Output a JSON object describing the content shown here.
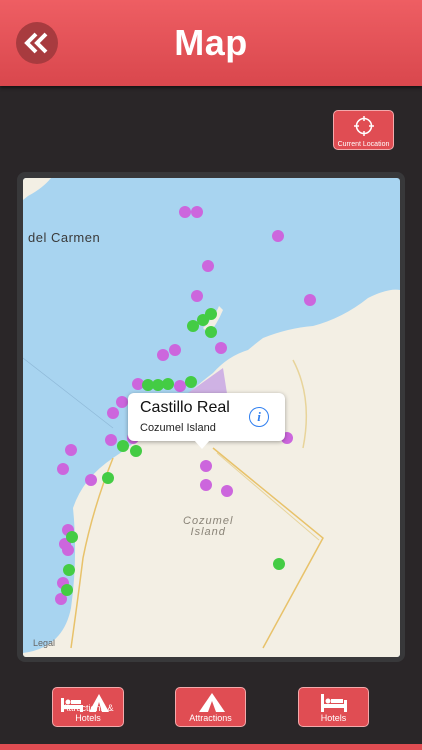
{
  "header": {
    "title": "Map",
    "back_icon": "double-chevron-left-icon"
  },
  "current_location": {
    "label": "Current Location",
    "icon": "crosshair-icon"
  },
  "map": {
    "city_label": "del Carmen",
    "island_label_line1": "Cozumel",
    "island_label_line2": "Island",
    "legal": "Legal",
    "pin_colors": {
      "attraction": "#cc66dd",
      "hotel": "#44cc44"
    },
    "callout": {
      "title": "Castillo Real",
      "subtitle": "Cozumel Island",
      "icon": "info-icon"
    }
  },
  "tabs": [
    {
      "label": "Attractions & Hotels",
      "icon": "bed-tent-icon"
    },
    {
      "label": "Attractions",
      "icon": "tent-icon"
    },
    {
      "label": "Hotels",
      "icon": "bed-icon"
    }
  ],
  "colors": {
    "accent": "#e04d53",
    "background": "#2a2628"
  }
}
